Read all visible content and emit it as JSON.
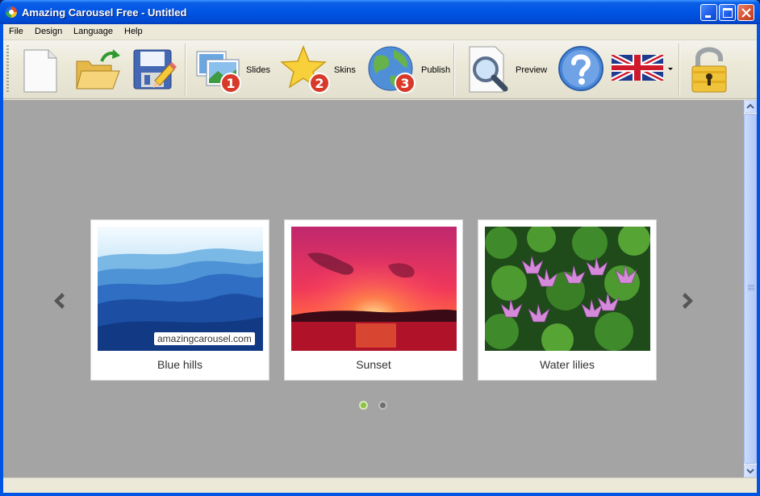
{
  "window": {
    "title": "Amazing Carousel Free - Untitled"
  },
  "menu": [
    "File",
    "Design",
    "Language",
    "Help"
  ],
  "toolbar": {
    "slides_label": "Slides",
    "skins_label": "Skins",
    "publish_label": "Publish",
    "preview_label": "Preview",
    "step_badges": [
      "1",
      "2",
      "3"
    ]
  },
  "carousel": {
    "slides": [
      {
        "caption": "Blue hills",
        "watermark": "amazingcarousel.com"
      },
      {
        "caption": "Sunset"
      },
      {
        "caption": "Water lilies"
      }
    ],
    "pagination": {
      "pages": 2,
      "active": 1,
      "active_color": "#8fc04a",
      "inactive_color": "#6f6f6f"
    }
  },
  "colors": {
    "titlebar": "#0055e5",
    "canvas": "#a4a4a4",
    "chrome": "#ece9d8"
  },
  "icons": [
    "app-logo-icon",
    "minimize-icon",
    "maximize-icon",
    "close-icon",
    "new-file-icon",
    "open-folder-icon",
    "save-disk-icon",
    "slides-icon",
    "skins-star-icon",
    "publish-globe-icon",
    "preview-magnifier-icon",
    "help-icon",
    "uk-flag-icon",
    "dropdown-arrow-icon",
    "lock-icon",
    "chevron-left-icon",
    "chevron-right-icon"
  ]
}
